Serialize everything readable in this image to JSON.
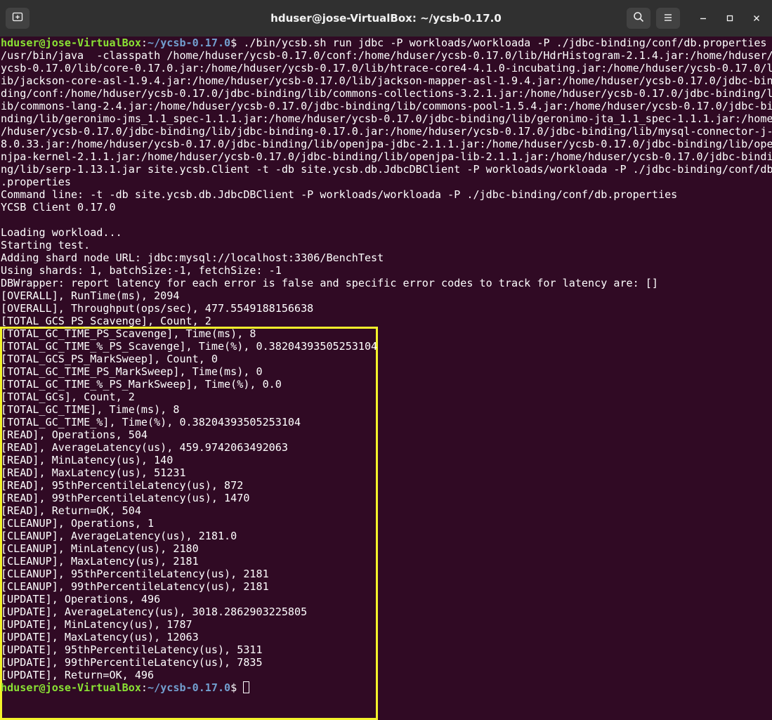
{
  "window": {
    "title": "hduser@jose-VirtualBox: ~/ycsb-0.17.0"
  },
  "icons": {
    "new_tab": "new-tab-icon",
    "search": "search-icon",
    "menu": "hamburger-menu-icon",
    "minimize": "minimize-icon",
    "maximize": "maximize-icon",
    "close": "close-icon"
  },
  "prompt": {
    "user": "hduser@jose-VirtualBox",
    "sep": ":",
    "path": "~/ycsb-0.17.0",
    "symbol": "$ "
  },
  "command": "./bin/ycsb.sh run jdbc -P workloads/workloada -P ./jdbc-binding/conf/db.properties",
  "output": [
    "/usr/bin/java  -classpath /home/hduser/ycsb-0.17.0/conf:/home/hduser/ycsb-0.17.0/lib/HdrHistogram-2.1.4.jar:/home/hduser/",
    "ycsb-0.17.0/lib/core-0.17.0.jar:/home/hduser/ycsb-0.17.0/lib/htrace-core4-4.1.0-incubating.jar:/home/hduser/ycsb-0.17.0/l",
    "ib/jackson-core-asl-1.9.4.jar:/home/hduser/ycsb-0.17.0/lib/jackson-mapper-asl-1.9.4.jar:/home/hduser/ycsb-0.17.0/jdbc-bin",
    "ding/conf:/home/hduser/ycsb-0.17.0/jdbc-binding/lib/commons-collections-3.2.1.jar:/home/hduser/ycsb-0.17.0/jdbc-binding/l",
    "ib/commons-lang-2.4.jar:/home/hduser/ycsb-0.17.0/jdbc-binding/lib/commons-pool-1.5.4.jar:/home/hduser/ycsb-0.17.0/jdbc-bi",
    "nding/lib/geronimo-jms_1.1_spec-1.1.1.jar:/home/hduser/ycsb-0.17.0/jdbc-binding/lib/geronimo-jta_1.1_spec-1.1.1.jar:/home",
    "/hduser/ycsb-0.17.0/jdbc-binding/lib/jdbc-binding-0.17.0.jar:/home/hduser/ycsb-0.17.0/jdbc-binding/lib/mysql-connector-j-",
    "8.0.33.jar:/home/hduser/ycsb-0.17.0/jdbc-binding/lib/openjpa-jdbc-2.1.1.jar:/home/hduser/ycsb-0.17.0/jdbc-binding/lib/ope",
    "njpa-kernel-2.1.1.jar:/home/hduser/ycsb-0.17.0/jdbc-binding/lib/openjpa-lib-2.1.1.jar:/home/hduser/ycsb-0.17.0/jdbc-bindi",
    "ng/lib/serp-1.13.1.jar site.ycsb.Client -t -db site.ycsb.db.JdbcDBClient -P workloads/workloada -P ./jdbc-binding/conf/db",
    ".properties",
    "Command line: -t -db site.ycsb.db.JdbcDBClient -P workloads/workloada -P ./jdbc-binding/conf/db.properties",
    "YCSB Client 0.17.0",
    "",
    "Loading workload...",
    "Starting test.",
    "Adding shard node URL: jdbc:mysql://localhost:3306/BenchTest",
    "Using shards: 1, batchSize:-1, fetchSize: -1",
    "DBWrapper: report latency for each error is false and specific error codes to track for latency are: []",
    "[OVERALL], RunTime(ms), 2094",
    "[OVERALL], Throughput(ops/sec), 477.5549188156638",
    "[TOTAL_GCS_PS_Scavenge], Count, 2",
    "[TOTAL_GC_TIME_PS_Scavenge], Time(ms), 8",
    "[TOTAL_GC_TIME_%_PS_Scavenge], Time(%), 0.38204393505253104",
    "[TOTAL_GCS_PS_MarkSweep], Count, 0",
    "[TOTAL_GC_TIME_PS_MarkSweep], Time(ms), 0",
    "[TOTAL_GC_TIME_%_PS_MarkSweep], Time(%), 0.0",
    "[TOTAL_GCs], Count, 2",
    "[TOTAL_GC_TIME], Time(ms), 8",
    "[TOTAL_GC_TIME_%], Time(%), 0.38204393505253104",
    "[READ], Operations, 504",
    "[READ], AverageLatency(us), 459.9742063492063",
    "[READ], MinLatency(us), 140",
    "[READ], MaxLatency(us), 51231",
    "[READ], 95thPercentileLatency(us), 872",
    "[READ], 99thPercentileLatency(us), 1470",
    "[READ], Return=OK, 504",
    "[CLEANUP], Operations, 1",
    "[CLEANUP], AverageLatency(us), 2181.0",
    "[CLEANUP], MinLatency(us), 2180",
    "[CLEANUP], MaxLatency(us), 2181",
    "[CLEANUP], 95thPercentileLatency(us), 2181",
    "[CLEANUP], 99thPercentileLatency(us), 2181",
    "[UPDATE], Operations, 496",
    "[UPDATE], AverageLatency(us), 3018.2862903225805",
    "[UPDATE], MinLatency(us), 1787",
    "[UPDATE], MaxLatency(us), 12063",
    "[UPDATE], 95thPercentileLatency(us), 5311",
    "[UPDATE], 99thPercentileLatency(us), 7835",
    "[UPDATE], Return=OK, 496"
  ],
  "colors": {
    "background": "#300a24",
    "titlebar": "#303030",
    "prompt_user": "#8ae234",
    "prompt_path": "#729fcf",
    "highlight_box": "#f3f32b",
    "text": "#ffffff"
  }
}
